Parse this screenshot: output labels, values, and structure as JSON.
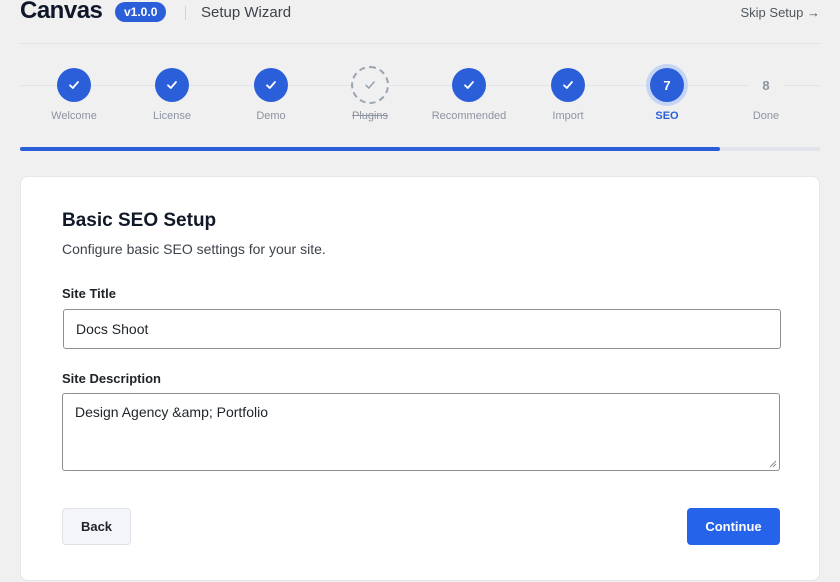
{
  "header": {
    "logo": "Canvas",
    "version": "v1.0.0",
    "title": "Setup Wizard",
    "skip_label": "Skip Setup →"
  },
  "steps": [
    {
      "label": "Welcome",
      "state": "done"
    },
    {
      "label": "License",
      "state": "done"
    },
    {
      "label": "Demo",
      "state": "done"
    },
    {
      "label": "Plugins",
      "state": "skipped"
    },
    {
      "label": "Recommended",
      "state": "done"
    },
    {
      "label": "Import",
      "state": "done"
    },
    {
      "label": "SEO",
      "state": "active",
      "number": "7"
    },
    {
      "label": "Done",
      "state": "pending",
      "number": "8"
    }
  ],
  "progress_fraction": 0.875,
  "card": {
    "title": "Basic SEO Setup",
    "description": "Configure basic SEO settings for your site.",
    "site_title_label": "Site Title",
    "site_title_value": "Docs Shoot",
    "site_description_label": "Site Description",
    "site_description_value": "Design Agency &amp; Portfolio"
  },
  "buttons": {
    "back": "Back",
    "continue": "Continue"
  },
  "colors": {
    "accent": "#2b5fd9",
    "button_primary": "#2563eb"
  },
  "icons": {
    "check": "check-icon",
    "arrow": "arrow-right-icon"
  }
}
